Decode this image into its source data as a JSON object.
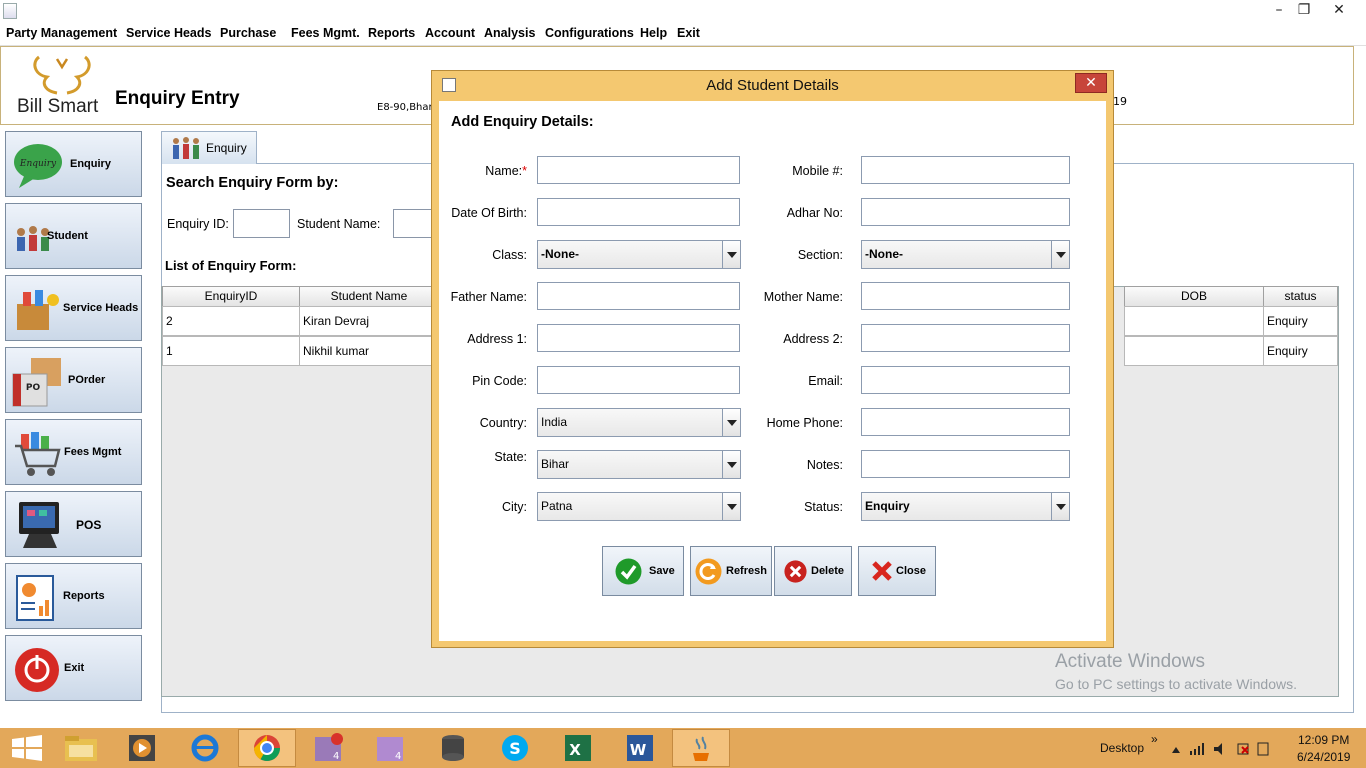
{
  "menu": {
    "items": [
      "Party Management",
      "Service Heads",
      "Purchase",
      "Fees Mgmt.",
      "Reports",
      "Account",
      "Analysis",
      "Configurations",
      "Help",
      "Exit"
    ]
  },
  "window_controls": {
    "minimize": "–",
    "restore": "❐",
    "close": "✕"
  },
  "header": {
    "logo_text": "Bill Smart",
    "page_title": "Enquiry Entry",
    "address_fragment": "E8-90,Bhara",
    "right_fragment": "19"
  },
  "sidebar": {
    "items": [
      {
        "label": "Enquiry",
        "icon": "enquiry-bubble-icon"
      },
      {
        "label": "Student",
        "icon": "students-icon"
      },
      {
        "label": "Service Heads",
        "icon": "service-box-icon"
      },
      {
        "label": "POrder",
        "icon": "purchase-order-icon"
      },
      {
        "label": "Fees Mgmt",
        "icon": "cart-icon"
      },
      {
        "label": "POS",
        "icon": "pos-terminal-icon"
      },
      {
        "label": "Reports",
        "icon": "report-chart-icon"
      },
      {
        "label": "Exit",
        "icon": "power-icon"
      }
    ]
  },
  "main": {
    "tab_label": "Enquiry",
    "search_title": "Search Enquiry Form by:",
    "enquiry_id_label": "Enquiry ID:",
    "student_name_label": "Student Name:",
    "list_title": "List of Enquiry Form:",
    "table": {
      "headers": [
        "EnquiryID",
        "Student Name",
        "DOB",
        "status"
      ],
      "rows": [
        {
          "id": "2",
          "name": "Kiran Devraj",
          "dob": "",
          "status": "Enquiry"
        },
        {
          "id": "1",
          "name": "Nikhil kumar",
          "dob": "",
          "status": "Enquiry"
        }
      ]
    }
  },
  "watermark": {
    "line1": "Activate Windows",
    "line2": "Go to PC settings to activate Windows."
  },
  "dialog": {
    "title": "Add Student Details",
    "heading": "Add Enquiry Details:",
    "close_glyph": "✕",
    "fields": {
      "name_label": "Name:",
      "name_required": "*",
      "mobile_label": "Mobile #:",
      "dob_label": "Date Of Birth:",
      "adhar_label": "Adhar No:",
      "class_label": "Class:",
      "class_value": "-None-",
      "section_label": "Section:",
      "section_value": "-None-",
      "father_label": "Father Name:",
      "mother_label": "Mother Name:",
      "address1_label": "Address 1:",
      "address2_label": "Address 2:",
      "pin_label": "Pin Code:",
      "email_label": "Email:",
      "country_label": "Country:",
      "country_value": "India",
      "home_phone_label": "Home Phone:",
      "state_label": "State:",
      "state_value": "Bihar",
      "notes_label": "Notes:",
      "city_label": "City:",
      "city_value": "Patna",
      "status_label": "Status:",
      "status_value": "Enquiry"
    },
    "buttons": {
      "save": "Save",
      "refresh": "Refresh",
      "delete": "Delete",
      "close": "Close"
    }
  },
  "taskbar": {
    "desktop_label": "Desktop",
    "chevron": "»",
    "time": "12:09 PM",
    "date": "6/24/2019"
  },
  "colors": {
    "dialog_frame": "#f4c870",
    "taskbar": "#e3a85a",
    "header_border": "#c8b27a"
  }
}
